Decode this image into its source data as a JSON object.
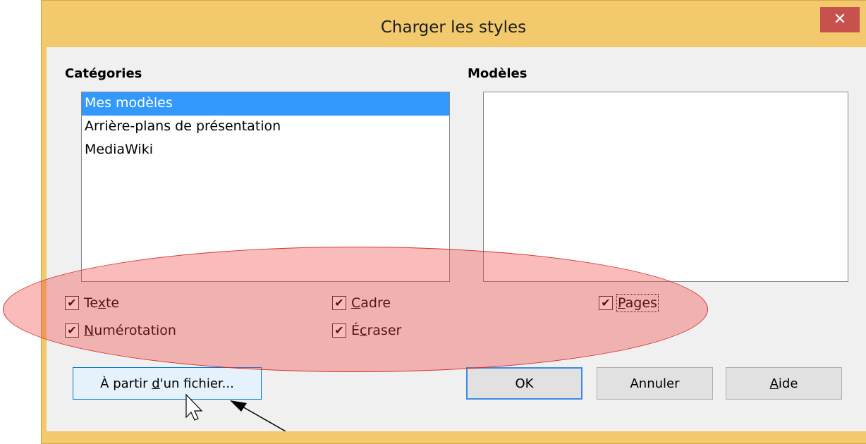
{
  "window": {
    "title": "Charger les styles",
    "close_glyph": "✕"
  },
  "categories": {
    "label": "Catégories",
    "items": [
      {
        "label": "Mes modèles",
        "selected": true
      },
      {
        "label": "Arrière-plans de présentation",
        "selected": false
      },
      {
        "label": "MediaWiki",
        "selected": false
      }
    ]
  },
  "models": {
    "label": "Modèles",
    "items": []
  },
  "options": {
    "texte": {
      "pre": "Te",
      "mn": "x",
      "post": "te",
      "checked": true
    },
    "numerotation": {
      "pre": "",
      "mn": "N",
      "post": "umérotation",
      "checked": true
    },
    "cadre": {
      "pre": "",
      "mn": "C",
      "post": "adre",
      "checked": true
    },
    "ecraser": {
      "pre": "É",
      "mn": "c",
      "post": "raser",
      "checked": true
    },
    "pages": {
      "pre": "",
      "mn": "P",
      "post": "ages",
      "checked": true
    }
  },
  "check_glyph": "✔",
  "buttons": {
    "from_file": {
      "pre": "À partir ",
      "mn": "d",
      "post": "'un fichier..."
    },
    "ok": "OK",
    "cancel": "Annuler",
    "help": {
      "mn": "A",
      "post": "ide"
    }
  },
  "annotation": {
    "highlight_color": "#f03c3c"
  }
}
